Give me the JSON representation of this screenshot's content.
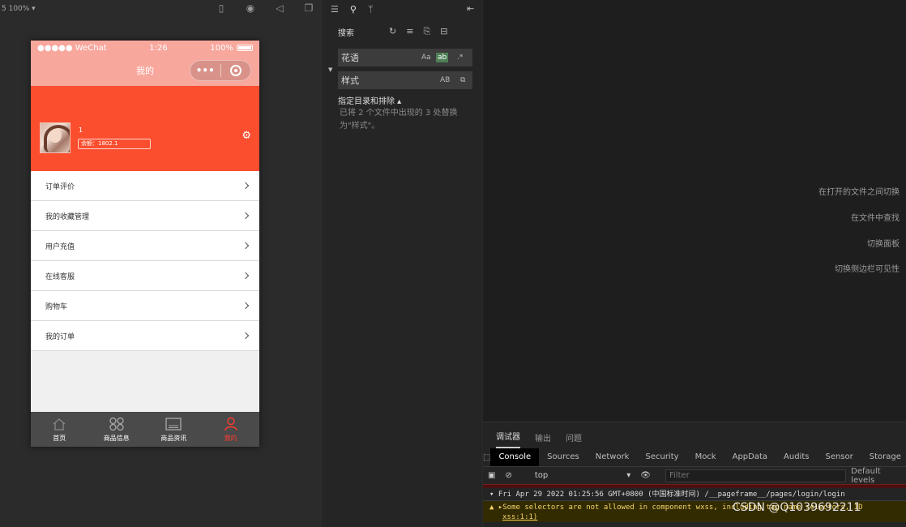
{
  "simulator": {
    "zoom_label": "5 100% ▾",
    "phone": {
      "status": {
        "carrier": "●●●●● WeChat",
        "time": "1:26",
        "battery": "100%"
      },
      "nav_title": "我的",
      "capsule_dots": "•••",
      "profile": {
        "name": "1",
        "balance": "余额：1802.1"
      },
      "menu": [
        {
          "label": "订单评价"
        },
        {
          "label": "我的收藏管理"
        },
        {
          "label": "用户充值"
        },
        {
          "label": "在线客服"
        },
        {
          "label": "购物车"
        },
        {
          "label": "我的订单"
        }
      ],
      "tabs": [
        {
          "label": "首页",
          "icon": "home-icon"
        },
        {
          "label": "商品信息",
          "icon": "grid-icon"
        },
        {
          "label": "商品资讯",
          "icon": "news-icon"
        },
        {
          "label": "我的",
          "icon": "user-icon",
          "active": true
        }
      ],
      "colors": {
        "header": "#f8a79d",
        "hero": "#fa4e2f",
        "tab_active": "#ff3b30"
      }
    }
  },
  "search": {
    "title": "搜索",
    "query": "花语",
    "replace": "样式",
    "case_label": "Aa",
    "word_label": "ab",
    "regex_label": ".*",
    "preserve_case_label": "AB",
    "include_label": "指定目录和排除 ▴",
    "result": "已将 2 个文件中出现的 3 处替换为\"样式\"。"
  },
  "editor": {
    "hints": [
      "在打开的文件之间切换",
      "在文件中查找",
      "切换面板",
      "切换侧边栏可见性"
    ]
  },
  "devtools": {
    "tabs": [
      "调试器",
      "输出",
      "问题"
    ],
    "panel_tabs": [
      "Console",
      "Sources",
      "Network",
      "Security",
      "Mock",
      "AppData",
      "Audits",
      "Sensor",
      "Storage"
    ],
    "context": "top",
    "filter_placeholder": "Filter",
    "levels": "Default levels",
    "log_group": "▾ Fri Apr 29 2022 01:25:56 GMT+0800 (中国标准时间) /__pageframe__/pages/login/login",
    "warning": "▲ ▸Some selectors are not allowed in component wxss, including tag name selectors, ID",
    "warning_loc": "xss:1:1)",
    "watermark": "CSDN @Q1039692211"
  }
}
